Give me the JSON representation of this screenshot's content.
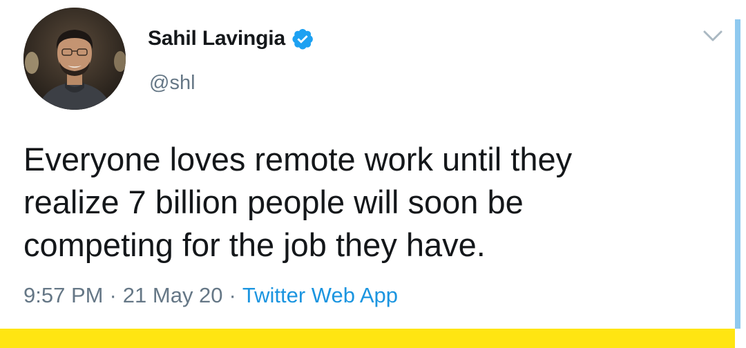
{
  "tweet": {
    "author": {
      "display_name": "Sahil Lavingia",
      "handle": "@shl",
      "verified": true
    },
    "text_lines": [
      "Everyone loves remote work until they",
      "realize 7 billion people will soon be",
      "competing for the job they have."
    ],
    "meta": {
      "time": "9:57 PM",
      "separator": "·",
      "date": "21 May 20",
      "source": "Twitter Web App"
    }
  },
  "icons": {
    "verified": "verified-badge-icon",
    "more": "chevron-down-icon"
  },
  "colors": {
    "verified_blue": "#1da1f2",
    "link_blue": "#1b95e0",
    "secondary_text": "#657786",
    "scrollbar": "#8fc9ef",
    "bottom_band": "#ffe512"
  }
}
